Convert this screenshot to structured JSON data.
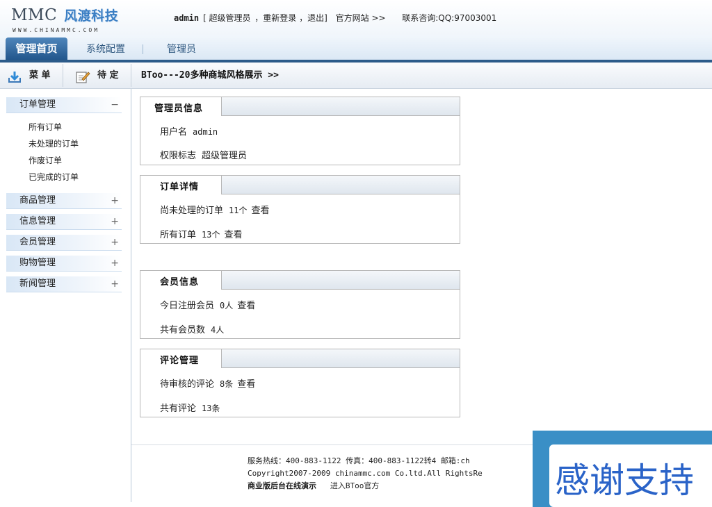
{
  "header": {
    "logo_main": "MMC",
    "logo_cn": "风渡科技",
    "logo_sub": "WWW.CHINAMMC.COM",
    "username": "admin",
    "role_text": "[ 超级管理员",
    "relogin": "，重新登录",
    "logout": "，退出]",
    "official_site": "官方网站 >>",
    "contact": "联系咨询:QQ:97003001"
  },
  "nav": {
    "tabs": [
      {
        "label": "管理首页"
      },
      {
        "label": "系统配置"
      },
      {
        "label": "管理员"
      }
    ]
  },
  "toolbar": {
    "menu_label": "菜 单",
    "pending_label": "待 定",
    "breadcrumb": "BToo---20多种商城风格展示 >>"
  },
  "sidebar": {
    "groups": [
      {
        "label": "订单管理",
        "sign": "−",
        "items": [
          "所有订单",
          "未处理的订单",
          "作废订单",
          "已完成的订单"
        ]
      },
      {
        "label": "商品管理",
        "sign": "+"
      },
      {
        "label": "信息管理",
        "sign": "+"
      },
      {
        "label": "会员管理",
        "sign": "+"
      },
      {
        "label": "购物管理",
        "sign": "+"
      },
      {
        "label": "新闻管理",
        "sign": "+"
      }
    ]
  },
  "panels": [
    {
      "title": "管理员信息",
      "rows": [
        {
          "label": "用户名",
          "value": "admin",
          "link": ""
        },
        {
          "label": "权限标志",
          "value": "超级管理员",
          "link": ""
        }
      ]
    },
    {
      "title": "订单详情",
      "rows": [
        {
          "label": "尚未处理的订单",
          "value": "11个",
          "link": "查看"
        },
        {
          "label": "所有订单",
          "value": "13个",
          "link": "查看"
        }
      ]
    },
    {
      "title": "会员信息",
      "rows": [
        {
          "label": "今日注册会员",
          "value": "0人",
          "link": "查看"
        },
        {
          "label": "共有会员数",
          "value": "4人",
          "link": ""
        }
      ]
    },
    {
      "title": "评论管理",
      "rows": [
        {
          "label": "待审核的评论",
          "value": "8条",
          "link": "查看"
        },
        {
          "label": "共有评论",
          "value": "13条",
          "link": ""
        }
      ]
    }
  ],
  "footer": {
    "line1": "服务热线：400-883-1122  传真：400-883-1122转4  邮箱:ch",
    "line2": "Copyright2007-2009 chinammc.com Co.ltd.All RightsRe",
    "line3_bold": "商业版后台在线演示",
    "line3_link": "进入BToo官方"
  },
  "popup": {
    "text": "感谢支持"
  },
  "colors": {
    "nav_active": "#22568c",
    "nav_bar": "#2c5b8a",
    "popup_bg": "#3a8fc6",
    "popup_text": "#2a63c8"
  }
}
